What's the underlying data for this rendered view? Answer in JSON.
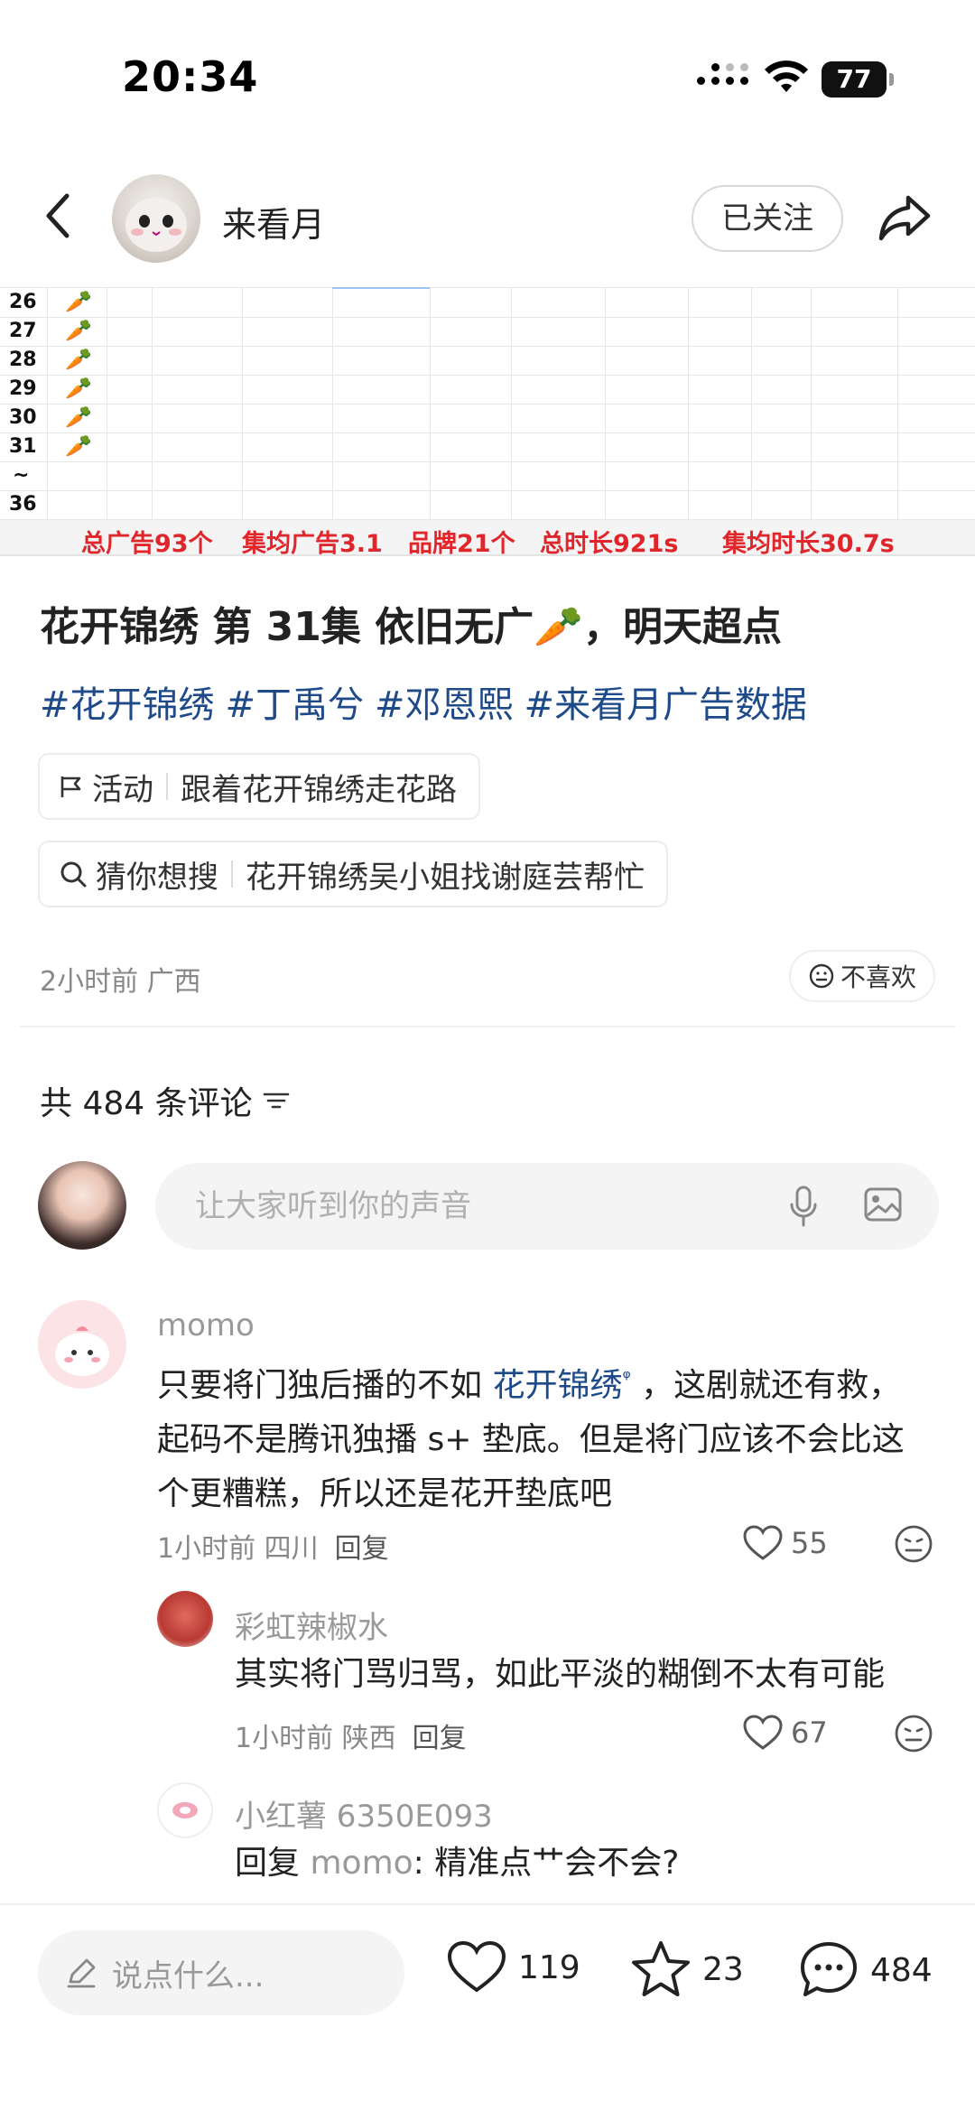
{
  "status_bar": {
    "time": "20:34",
    "battery": "77"
  },
  "header": {
    "author_name": "来看月",
    "follow_label": "已关注"
  },
  "sheet": {
    "rows": [
      "26",
      "27",
      "28",
      "29",
      "30",
      "31",
      "~",
      "36"
    ],
    "carrot": "🥕",
    "summary": {
      "total_ads": "总广告93个",
      "avg_ads": "集均广告3.1",
      "brands": "品牌21个",
      "total_duration": "总时长921s",
      "avg_duration": "集均时长30.7s"
    }
  },
  "post": {
    "title": "花开锦绣  第 31集 依旧无广🥕，明天超点",
    "tags": [
      "#花开锦绣",
      "#丁禹兮",
      "#邓恩熙",
      "#来看月广告数据"
    ],
    "activity": {
      "label": "活动",
      "text": "跟着花开锦绣走花路"
    },
    "guess": {
      "label": "猜你想搜",
      "text": "花开锦绣吴小姐找谢庭芸帮忙"
    },
    "meta": "2小时前 广西",
    "dislike_label": "不喜欢"
  },
  "comments_section": {
    "count_label": "共 484 条评论",
    "input_placeholder": "让大家听到你的声音",
    "comments": [
      {
        "name": "momo",
        "text_before": "只要将门独后播的不如 ",
        "link": "花开锦绣",
        "text_after": " ，这剧就还有救，起码不是腾讯独播 s+ 垫底。但是将门应该不会比这个更糟糕，所以还是花开垫底吧",
        "meta": "1小时前 四川",
        "reply_label": "回复",
        "likes": "55"
      },
      {
        "name": "彩虹辣椒水",
        "text": "其实将门骂归骂，如此平淡的糊倒不太有可能",
        "meta": "1小时前 陕西",
        "reply_label": "回复",
        "likes": "67"
      },
      {
        "name": "小红薯 6350E093",
        "reply_prefix": "回复",
        "reply_to": "momo",
        "text": ": 精准点艹会不会?"
      }
    ]
  },
  "bottom_bar": {
    "placeholder": "说点什么...",
    "likes": "119",
    "stars": "23",
    "comments": "484"
  }
}
